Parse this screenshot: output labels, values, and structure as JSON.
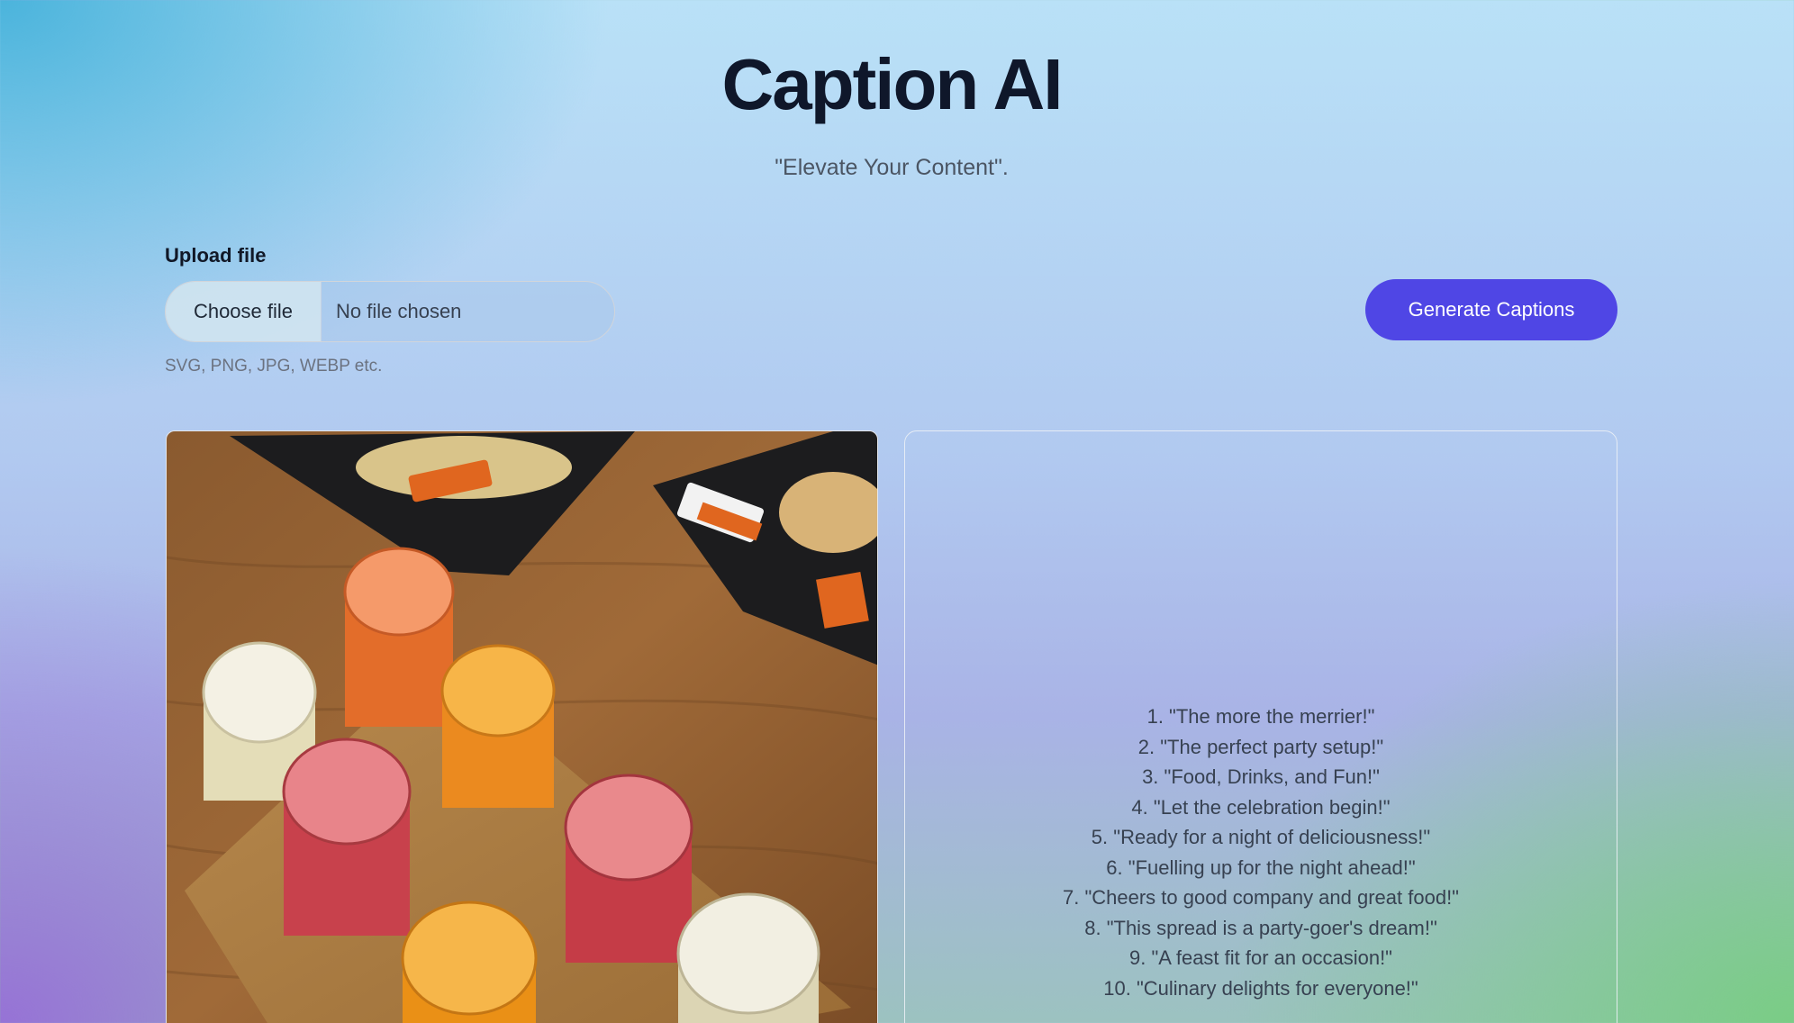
{
  "header": {
    "title": "Caption AI",
    "subtitle": "\"Elevate Your Content\"."
  },
  "upload": {
    "label": "Upload file",
    "choose_button": "Choose file",
    "file_status": "No file chosen",
    "hint": "SVG, PNG, JPG, WEBP etc."
  },
  "actions": {
    "generate_label": "Generate Captions"
  },
  "colors": {
    "accent": "#4f46e5"
  },
  "captions": [
    "1. \"The more the merrier!\"",
    "2. \"The perfect party setup!\"",
    "3. \"Food, Drinks, and Fun!\"",
    "4. \"Let the celebration begin!\"",
    "5. \"Ready for a night of deliciousness!\"",
    "6. \"Fuelling up for the night ahead!\"",
    "7. \"Cheers to good company and great food!\"",
    "8. \"This spread is a party-goer's dream!\"",
    "9. \"A feast fit for an occasion!\"",
    "10. \"Culinary delights for everyone!\""
  ]
}
